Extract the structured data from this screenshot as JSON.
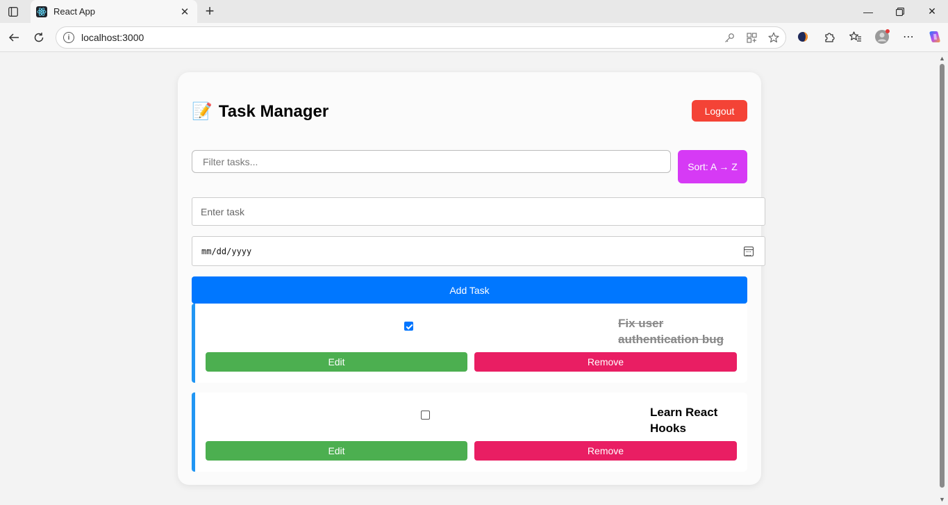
{
  "browser": {
    "tab_title": "React App",
    "url": "localhost:3000",
    "icons": {
      "tab_favicon": "react-icon",
      "back": "back-arrow-icon",
      "refresh": "refresh-icon",
      "site_info": "info-icon"
    }
  },
  "app": {
    "title_emoji": "📝",
    "title": "Task Manager",
    "logout_label": "Logout",
    "filter_placeholder": "Filter tasks...",
    "sort_label": "Sort: A → Z",
    "task_placeholder": "Enter task",
    "date_placeholder": "mm/dd/yyyy",
    "add_label": "Add Task",
    "colors": {
      "logout": "#f44336",
      "sort": "#d63af5",
      "add": "#0077ff",
      "edit": "#4caf50",
      "remove": "#e91e63",
      "task_accent": "#2196f3"
    }
  },
  "tasks": [
    {
      "text": "Fix user authentication bug",
      "completed": true,
      "edit_label": "Edit",
      "remove_label": "Remove"
    },
    {
      "text": "Learn React Hooks",
      "completed": false,
      "edit_label": "Edit",
      "remove_label": "Remove"
    }
  ]
}
